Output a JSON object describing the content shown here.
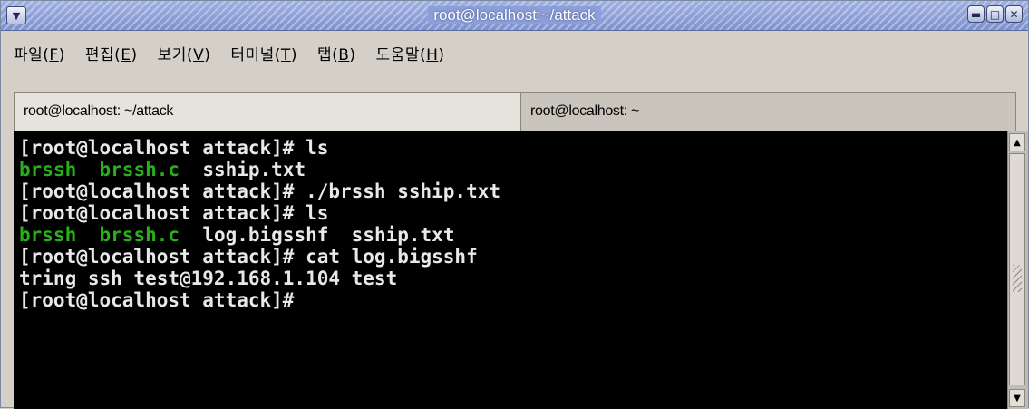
{
  "window": {
    "title": "root@localhost:~/attack",
    "menu_icon": "chevron-down-icon",
    "buttons": [
      "minimize-icon",
      "maximize-icon",
      "close-icon"
    ]
  },
  "menubar": {
    "items": [
      {
        "label": "파일(",
        "key": "F",
        "end": ")"
      },
      {
        "label": "편집(",
        "key": "E",
        "end": ")"
      },
      {
        "label": "보기(",
        "key": "V",
        "end": ")"
      },
      {
        "label": "터미널(",
        "key": "T",
        "end": ")"
      },
      {
        "label": "탭(",
        "key": "B",
        "end": ")"
      },
      {
        "label": "도움말(",
        "key": "H",
        "end": ")"
      }
    ]
  },
  "tabs": [
    {
      "label": "root@localhost: ~/attack",
      "active": true
    },
    {
      "label": "root@localhost: ~",
      "active": false
    }
  ],
  "terminal": {
    "lines": [
      {
        "segments": [
          {
            "text": "[root@localhost attack]# ls",
            "color": "default"
          }
        ]
      },
      {
        "segments": [
          {
            "text": "brssh",
            "color": "green"
          },
          {
            "text": "  ",
            "color": "default"
          },
          {
            "text": "brssh.c",
            "color": "green"
          },
          {
            "text": "  sship.txt",
            "color": "default"
          }
        ]
      },
      {
        "segments": [
          {
            "text": "[root@localhost attack]# ./brssh sship.txt",
            "color": "default"
          }
        ]
      },
      {
        "segments": [
          {
            "text": "[root@localhost attack]# ls",
            "color": "default"
          }
        ]
      },
      {
        "segments": [
          {
            "text": "brssh",
            "color": "green"
          },
          {
            "text": "  ",
            "color": "default"
          },
          {
            "text": "brssh.c",
            "color": "green"
          },
          {
            "text": "  log.bigsshf  sship.txt",
            "color": "default"
          }
        ]
      },
      {
        "segments": [
          {
            "text": "[root@localhost attack]# cat log.bigsshf",
            "color": "default"
          }
        ]
      },
      {
        "segments": [
          {
            "text": "tring ssh test@192.168.1.104 test",
            "color": "default"
          }
        ]
      },
      {
        "segments": [
          {
            "text": "[root@localhost attack]#",
            "color": "default"
          }
        ]
      }
    ]
  },
  "colors": {
    "terminal_bg": "#000000",
    "terminal_fg": "#e8e8e8",
    "executable_green": "#27b01a",
    "titlebar": "#8d9fd9"
  }
}
